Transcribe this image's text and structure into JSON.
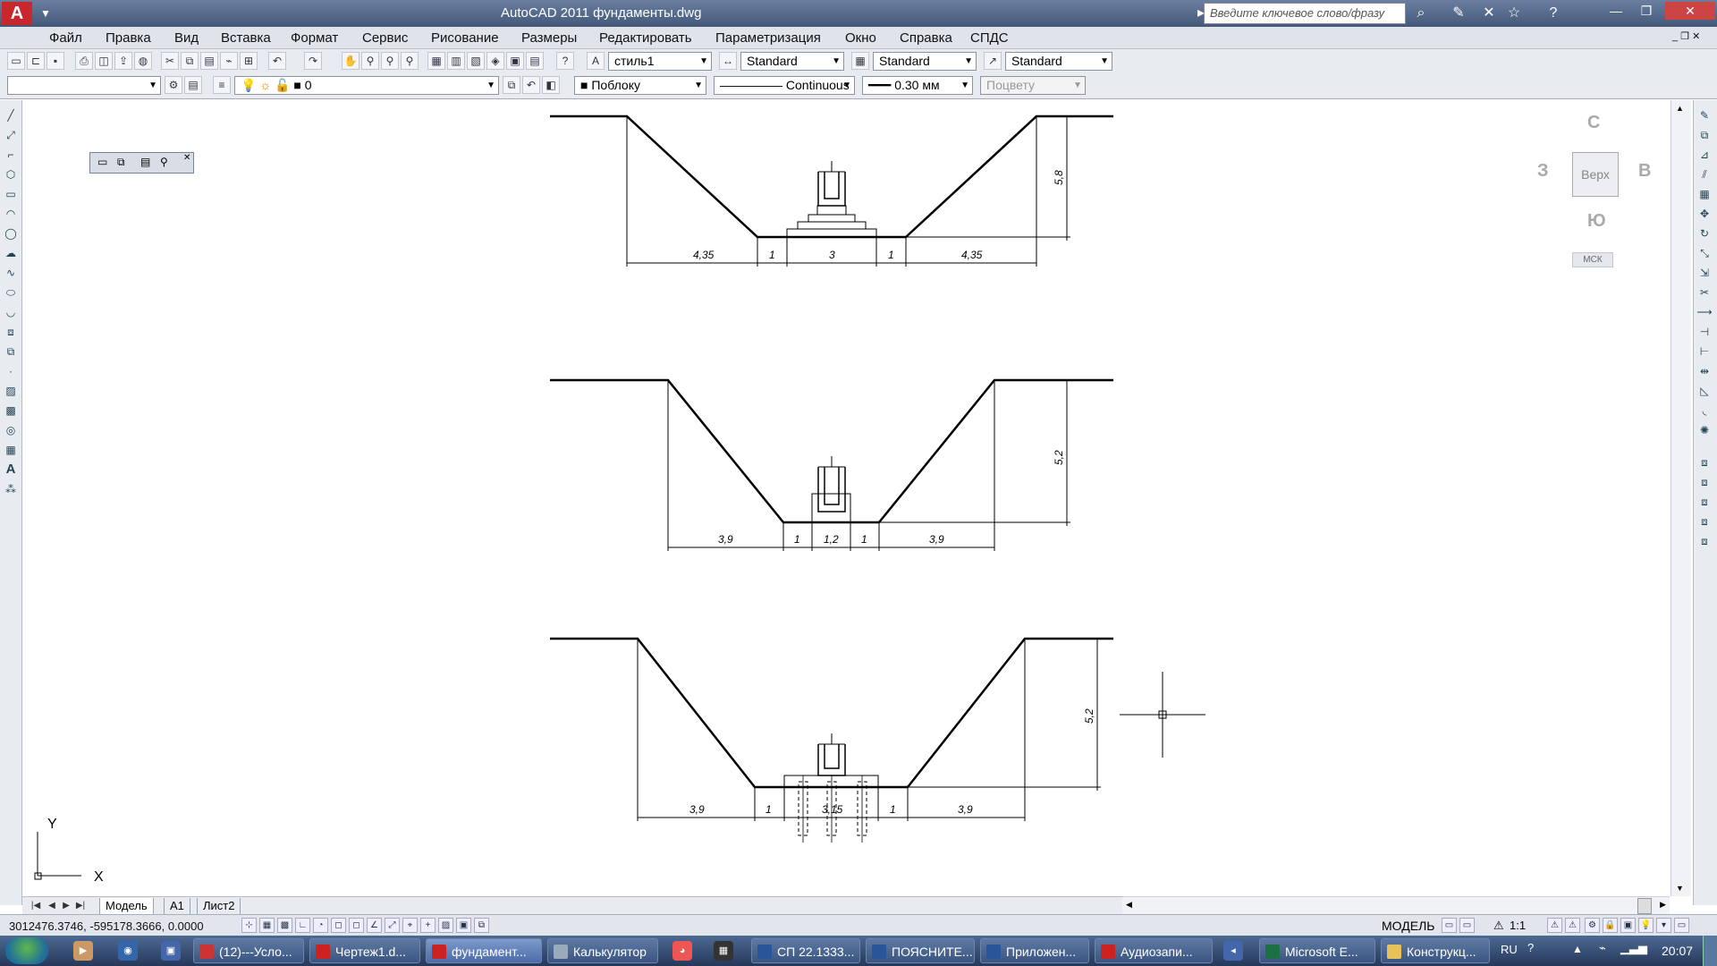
{
  "window": {
    "title": "AutoCAD 2011    фундаменты.dwg",
    "search_placeholder": "Введите ключевое слово/фразу"
  },
  "menu": [
    "Файл",
    "Правка",
    "Вид",
    "Вставка",
    "Формат",
    "Сервис",
    "Рисование",
    "Размеры",
    "Редактировать",
    "Параметризация",
    "Окно",
    "Справка",
    "СПДС"
  ],
  "toolbar1": {
    "text_style": "стиль1",
    "dim_style": "Standard",
    "table_style": "Standard",
    "mleader_style": "Standard"
  },
  "toolbar2": {
    "workspace": "",
    "layer": "0",
    "color": "Поблоку",
    "linetype": "Continuous",
    "lineweight": "0.30 мм",
    "plotstyle": "Поцвету"
  },
  "viewcube": {
    "top": "Верх",
    "n": "С",
    "s": "Ю",
    "w": "З",
    "e": "В",
    "wcs": "МСК"
  },
  "ucs": {
    "x": "X",
    "y": "Y"
  },
  "drawing": {
    "section1": {
      "left": "4,35",
      "gap1": "1",
      "base": "3",
      "gap2": "1",
      "right": "4,35",
      "depth": "5,8"
    },
    "section2": {
      "left": "3,9",
      "gap1": "1",
      "base": "1,2",
      "gap2": "1",
      "right": "3,9",
      "depth": "5,2"
    },
    "section3": {
      "left": "3,9",
      "gap1": "1",
      "base": "3,15",
      "gap2": "1",
      "right": "3,9",
      "depth": "5,2"
    }
  },
  "layout_tabs": [
    "Модель",
    "А1",
    "Лист2"
  ],
  "status": {
    "coords": "3012476.3746, -595178.3666, 0.0000",
    "model": "МОДЕЛЬ",
    "scale": "1:1"
  },
  "taskbar": {
    "items": [
      "(12)---Усло...",
      "Чертеж1.d...",
      "фундамент...",
      "Калькулятор",
      "СП 22.1333...",
      "ПОЯСНИТЕ...",
      "Приложен...",
      "Аудиозапи...",
      "Microsoft E...",
      "Конструкц..."
    ],
    "lang": "RU",
    "time": "20:07"
  }
}
